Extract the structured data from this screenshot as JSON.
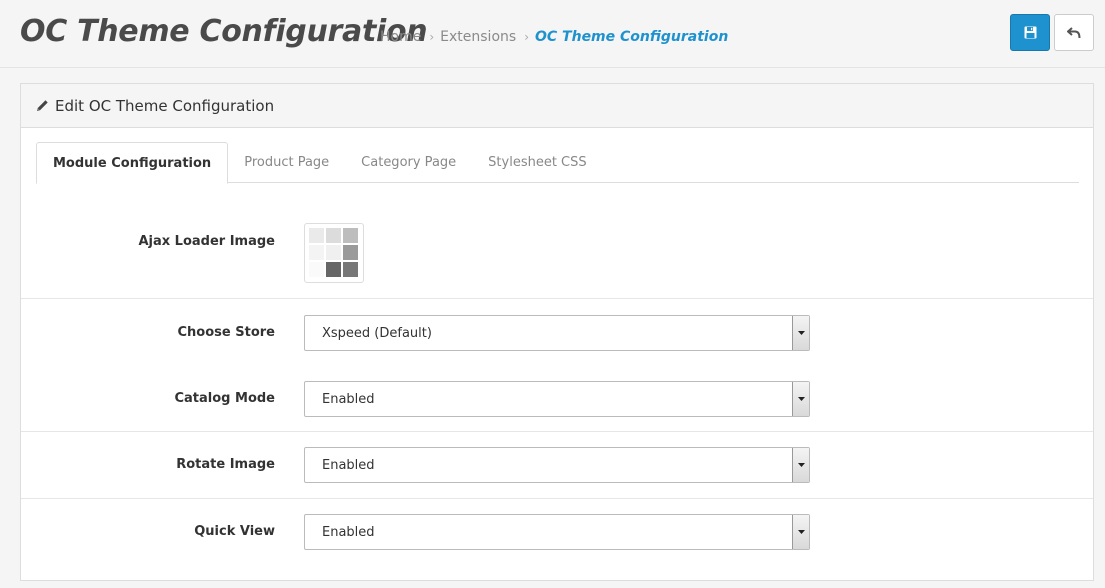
{
  "header": {
    "title": "OC Theme Configuration",
    "breadcrumb": [
      "Home",
      "Extensions",
      "OC Theme Configuration"
    ],
    "save_icon": "floppy-disk-icon",
    "back_icon": "reply-arrow-icon"
  },
  "panel": {
    "heading": "Edit OC Theme Configuration",
    "heading_icon": "pencil-icon"
  },
  "tabs": [
    "Module Configuration",
    "Product Page",
    "Category Page",
    "Stylesheet CSS"
  ],
  "form": {
    "ajax_loader_label": "Ajax Loader Image",
    "store_label": "Choose Store",
    "store_value": "Xspeed (Default)",
    "catalog_label": "Catalog Mode",
    "catalog_value": "Enabled",
    "rotate_label": "Rotate Image",
    "rotate_value": "Enabled",
    "quickview_label": "Quick View",
    "quickview_value": "Enabled"
  },
  "colors": {
    "primary": "#1e91cf",
    "breadcrumb_active": "#1e91cf"
  }
}
